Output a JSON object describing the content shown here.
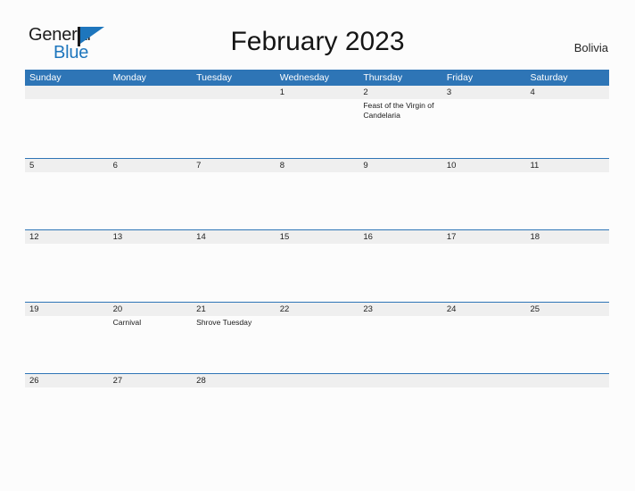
{
  "brand": {
    "name_top": "General",
    "name_bottom": "Blue",
    "flag_icon": "flag-triangle-icon",
    "accent_color": "#1e76bd"
  },
  "header": {
    "title": "February 2023",
    "country": "Bolivia"
  },
  "theme": {
    "header_blue": "#2e75b6",
    "row_band_gray": "#efefef",
    "page_background": "#fcfcfc",
    "text_color": "#1a1a1a"
  },
  "calendar": {
    "month": "February",
    "year": "2023",
    "weekday_headers": [
      "Sunday",
      "Monday",
      "Tuesday",
      "Wednesday",
      "Thursday",
      "Friday",
      "Saturday"
    ],
    "weeks": [
      [
        {
          "day": "",
          "events": []
        },
        {
          "day": "",
          "events": []
        },
        {
          "day": "",
          "events": []
        },
        {
          "day": "1",
          "events": []
        },
        {
          "day": "2",
          "events": [
            "Feast of the Virgin of Candelaria"
          ]
        },
        {
          "day": "3",
          "events": []
        },
        {
          "day": "4",
          "events": []
        }
      ],
      [
        {
          "day": "5",
          "events": []
        },
        {
          "day": "6",
          "events": []
        },
        {
          "day": "7",
          "events": []
        },
        {
          "day": "8",
          "events": []
        },
        {
          "day": "9",
          "events": []
        },
        {
          "day": "10",
          "events": []
        },
        {
          "day": "11",
          "events": []
        }
      ],
      [
        {
          "day": "12",
          "events": []
        },
        {
          "day": "13",
          "events": []
        },
        {
          "day": "14",
          "events": []
        },
        {
          "day": "15",
          "events": []
        },
        {
          "day": "16",
          "events": []
        },
        {
          "day": "17",
          "events": []
        },
        {
          "day": "18",
          "events": []
        }
      ],
      [
        {
          "day": "19",
          "events": []
        },
        {
          "day": "20",
          "events": [
            "Carnival"
          ]
        },
        {
          "day": "21",
          "events": [
            "Shrove Tuesday"
          ]
        },
        {
          "day": "22",
          "events": []
        },
        {
          "day": "23",
          "events": []
        },
        {
          "day": "24",
          "events": []
        },
        {
          "day": "25",
          "events": []
        }
      ],
      [
        {
          "day": "26",
          "events": []
        },
        {
          "day": "27",
          "events": []
        },
        {
          "day": "28",
          "events": []
        },
        {
          "day": "",
          "events": []
        },
        {
          "day": "",
          "events": []
        },
        {
          "day": "",
          "events": []
        },
        {
          "day": "",
          "events": []
        }
      ]
    ]
  }
}
